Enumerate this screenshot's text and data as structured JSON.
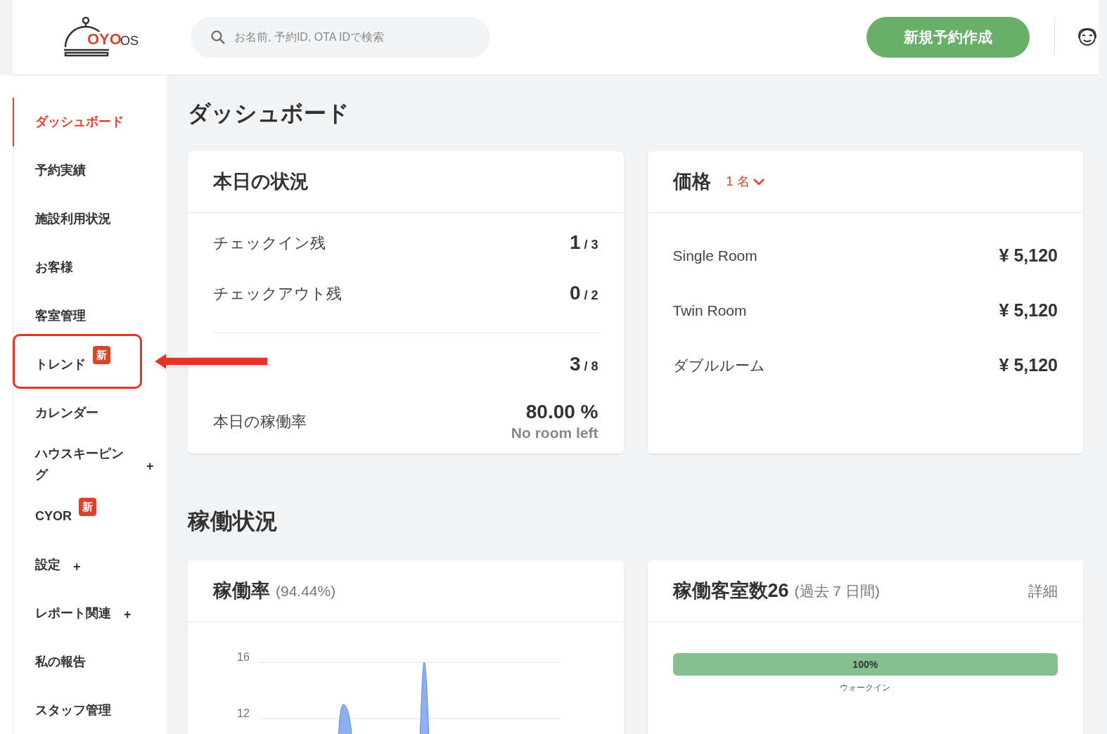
{
  "header": {
    "logo": {
      "brand": "OYO",
      "suffix": "OS"
    },
    "search": {
      "placeholder": "お名前, 予約ID, OTA IDで検索"
    },
    "new_booking_button": "新規予約作成"
  },
  "sidebar": {
    "items": [
      {
        "label": "ダッシュボード",
        "selected": true
      },
      {
        "label": "予約実績",
        "selected": false
      },
      {
        "label": "施設利用状況",
        "selected": false
      },
      {
        "label": "お客様",
        "selected": false
      },
      {
        "label": "客室管理",
        "selected": false
      },
      {
        "label": "トレンド",
        "selected": false,
        "badge": "新",
        "highlighted": true
      },
      {
        "label": "カレンダー",
        "selected": false
      },
      {
        "label": "ハウスキーピング",
        "selected": false,
        "expand_icon": "+"
      },
      {
        "label": "CYOR",
        "selected": false,
        "badge": "新"
      },
      {
        "label": "設定",
        "selected": false,
        "expand_icon": "+"
      },
      {
        "label": "レポート関連",
        "selected": false,
        "expand_icon": "+"
      },
      {
        "label": "私の報告",
        "selected": false
      },
      {
        "label": "スタッフ管理",
        "selected": false
      }
    ]
  },
  "page_title": "ダッシュボード",
  "today": {
    "title": "本日の状況",
    "rows": [
      {
        "label": "チェックイン残",
        "value": "1",
        "total": "/ 3"
      },
      {
        "label": "チェックアウト残",
        "value": "0",
        "total": "/ 2"
      },
      {
        "value": "3",
        "total": "/ 8"
      }
    ],
    "occupancy": {
      "label": "本日の稼働率",
      "value": "80.00 %",
      "note": "No room left"
    }
  },
  "price": {
    "title": "価格",
    "guests": "1 名",
    "rows": [
      {
        "room": "Single Room",
        "price": "¥ 5,120"
      },
      {
        "room": "Twin Room",
        "price": "¥ 5,120"
      },
      {
        "room": "ダブルルーム",
        "price": "¥ 5,120"
      }
    ]
  },
  "section_title": "稼働状況",
  "occupancy_card": {
    "title": "稼働率",
    "subtitle": "(94.44%)",
    "y_ticks": [
      "16",
      "12"
    ]
  },
  "rooms_card": {
    "title": "稼働客室数26",
    "subtitle": "(過去 7 日間)",
    "link": "詳細",
    "bar": {
      "level": 1,
      "label": "100%",
      "caption": "ウォークイン"
    }
  }
}
